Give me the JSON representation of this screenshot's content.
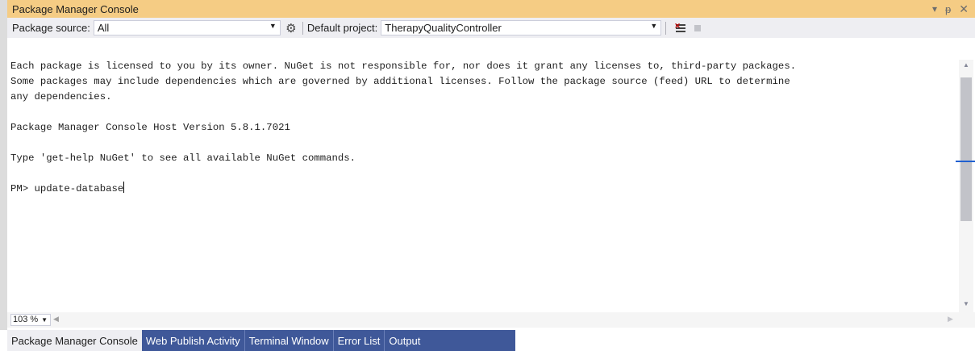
{
  "window": {
    "title": "Package Manager Console"
  },
  "toolbar": {
    "source_label": "Package source:",
    "source_value": "All",
    "project_label": "Default project:",
    "project_value": "TherapyQualityController"
  },
  "console": {
    "lines": [
      "Each package is licensed to you by its owner. NuGet is not responsible for, nor does it grant any licenses to, third-party packages.",
      "Some packages may include dependencies which are governed by additional licenses. Follow the package source (feed) URL to determine",
      "any dependencies.",
      "",
      "Package Manager Console Host Version 5.8.1.7021",
      "",
      "Type 'get-help NuGet' to see all available NuGet commands.",
      "",
      "PM> update-database"
    ]
  },
  "zoom": {
    "value": "103 %"
  },
  "tabs": [
    {
      "label": "Package Manager Console",
      "active": true
    },
    {
      "label": "Web Publish Activity"
    },
    {
      "label": "Terminal Window"
    },
    {
      "label": "Error List"
    },
    {
      "label": "Output"
    }
  ]
}
